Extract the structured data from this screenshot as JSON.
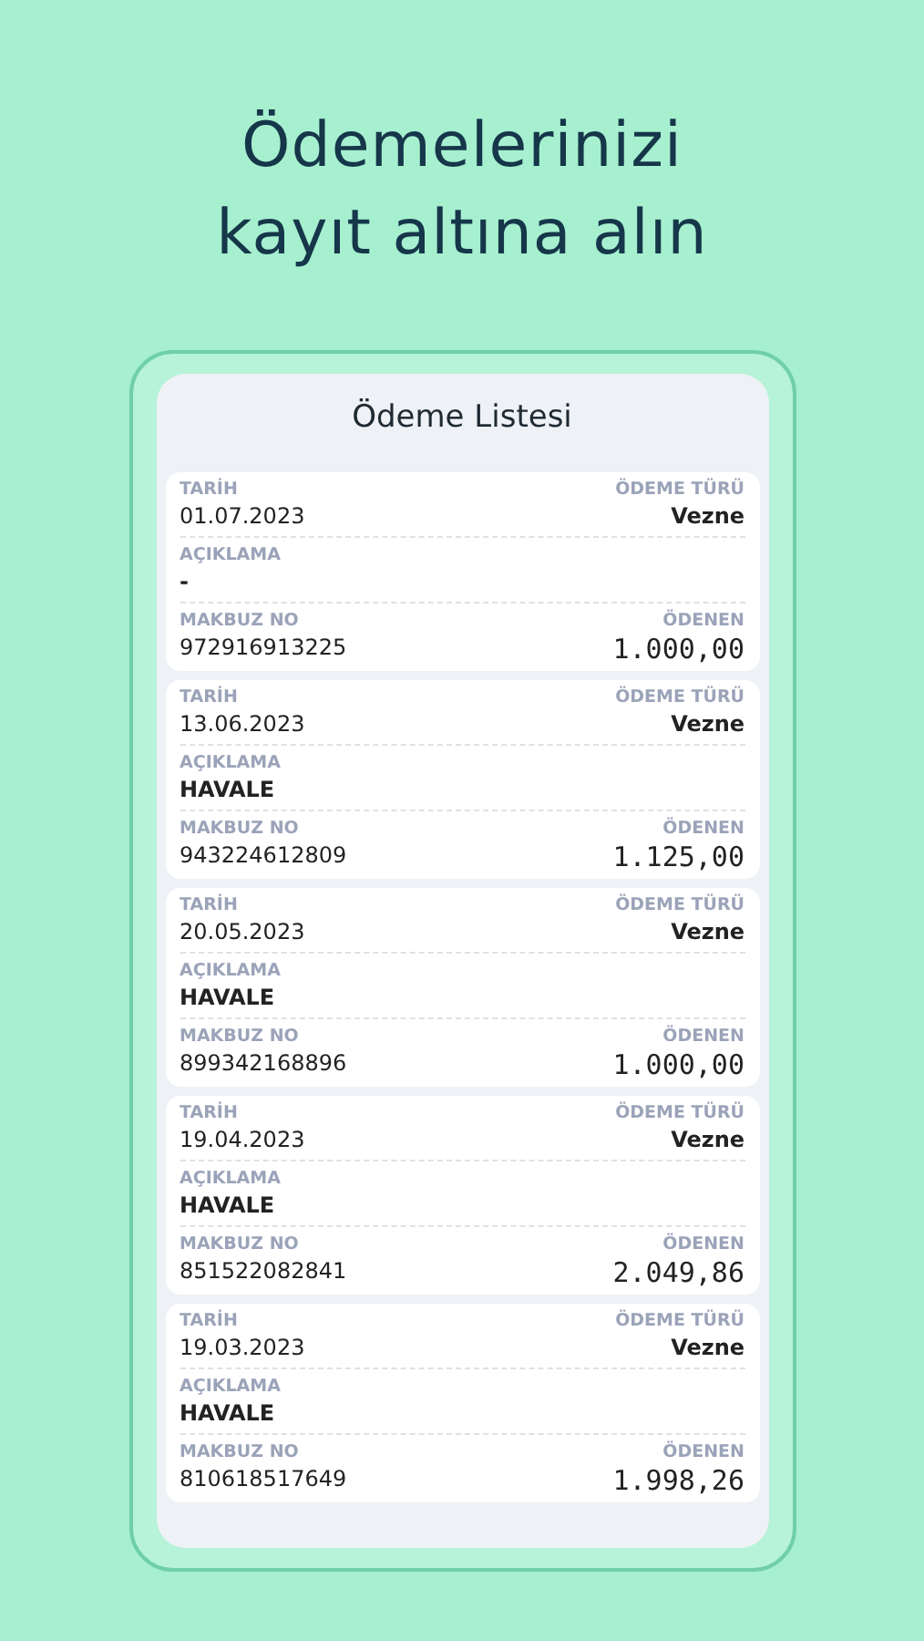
{
  "headline": [
    "Ödemelerinizi",
    "kayıt altına alın"
  ],
  "screen": {
    "title": "Ödeme Listesi",
    "payments": [
      {
        "date_label": "TARİH",
        "date": "01.07.2023",
        "type_label": "ÖDEME TÜRÜ",
        "type": "Vezne",
        "desc_label": "AÇIKLAMA",
        "desc": "-",
        "receipt_label": "MAKBUZ NO",
        "receipt": "972916913225",
        "paid_label": "ÖDENEN",
        "amount": "1.000,00"
      },
      {
        "date_label": "TARİH",
        "date": "13.06.2023",
        "type_label": "ÖDEME TÜRÜ",
        "type": "Vezne",
        "desc_label": "AÇIKLAMA",
        "desc": "HAVALE",
        "receipt_label": "MAKBUZ NO",
        "receipt": "943224612809",
        "paid_label": "ÖDENEN",
        "amount": "1.125,00"
      },
      {
        "date_label": "TARİH",
        "date": "20.05.2023",
        "type_label": "ÖDEME TÜRÜ",
        "type": "Vezne",
        "desc_label": "AÇIKLAMA",
        "desc": "HAVALE",
        "receipt_label": "MAKBUZ NO",
        "receipt": "899342168896",
        "paid_label": "ÖDENEN",
        "amount": "1.000,00"
      },
      {
        "date_label": "TARİH",
        "date": "19.04.2023",
        "type_label": "ÖDEME TÜRÜ",
        "type": "Vezne",
        "desc_label": "AÇIKLAMA",
        "desc": "HAVALE",
        "receipt_label": "MAKBUZ NO",
        "receipt": "851522082841",
        "paid_label": "ÖDENEN",
        "amount": "2.049,86"
      },
      {
        "date_label": "TARİH",
        "date": "19.03.2023",
        "type_label": "ÖDEME TÜRÜ",
        "type": "Vezne",
        "desc_label": "AÇIKLAMA",
        "desc": "HAVALE",
        "receipt_label": "MAKBUZ NO",
        "receipt": "810618517649",
        "paid_label": "ÖDENEN",
        "amount": "1.998,26"
      }
    ]
  }
}
